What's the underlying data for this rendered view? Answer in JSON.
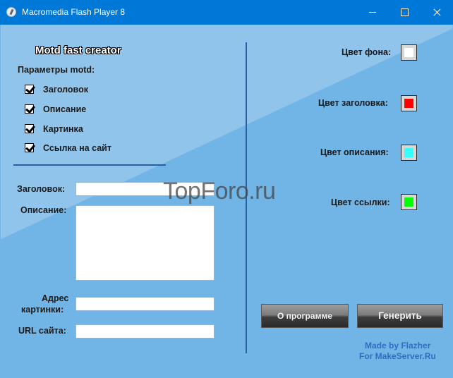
{
  "window": {
    "title": "Macromedia Flash Player 8"
  },
  "app": {
    "title": "Motd fast creator",
    "params_header": "Параметры motd:",
    "checkboxes": [
      {
        "label": "Заголовок",
        "checked": true
      },
      {
        "label": "Описание",
        "checked": true
      },
      {
        "label": "Картинка",
        "checked": true
      },
      {
        "label": "Ссылка на сайт",
        "checked": true
      }
    ],
    "form": {
      "title_label": "Заголовок:",
      "title_value": "",
      "description_label": "Описание:",
      "description_value": "",
      "image_label_line1": "Адрес",
      "image_label_line2": "картинки:",
      "image_value": "",
      "url_label": "URL сайта:",
      "url_value": ""
    },
    "colors": [
      {
        "label": "Цвет фона:",
        "value": "#ffffff"
      },
      {
        "label": "Цвет заголовка:",
        "value": "#ff0000"
      },
      {
        "label": "Цвет описания:",
        "value": "#33ffff"
      },
      {
        "label": "Цвет ссылки:",
        "value": "#00ff00"
      }
    ],
    "buttons": {
      "about": "О программе",
      "generate": "Генерить"
    },
    "credits": {
      "line1": "Made by Flazher",
      "line2": "For MakeServer.Ru"
    },
    "watermark": "TopForo.ru"
  }
}
